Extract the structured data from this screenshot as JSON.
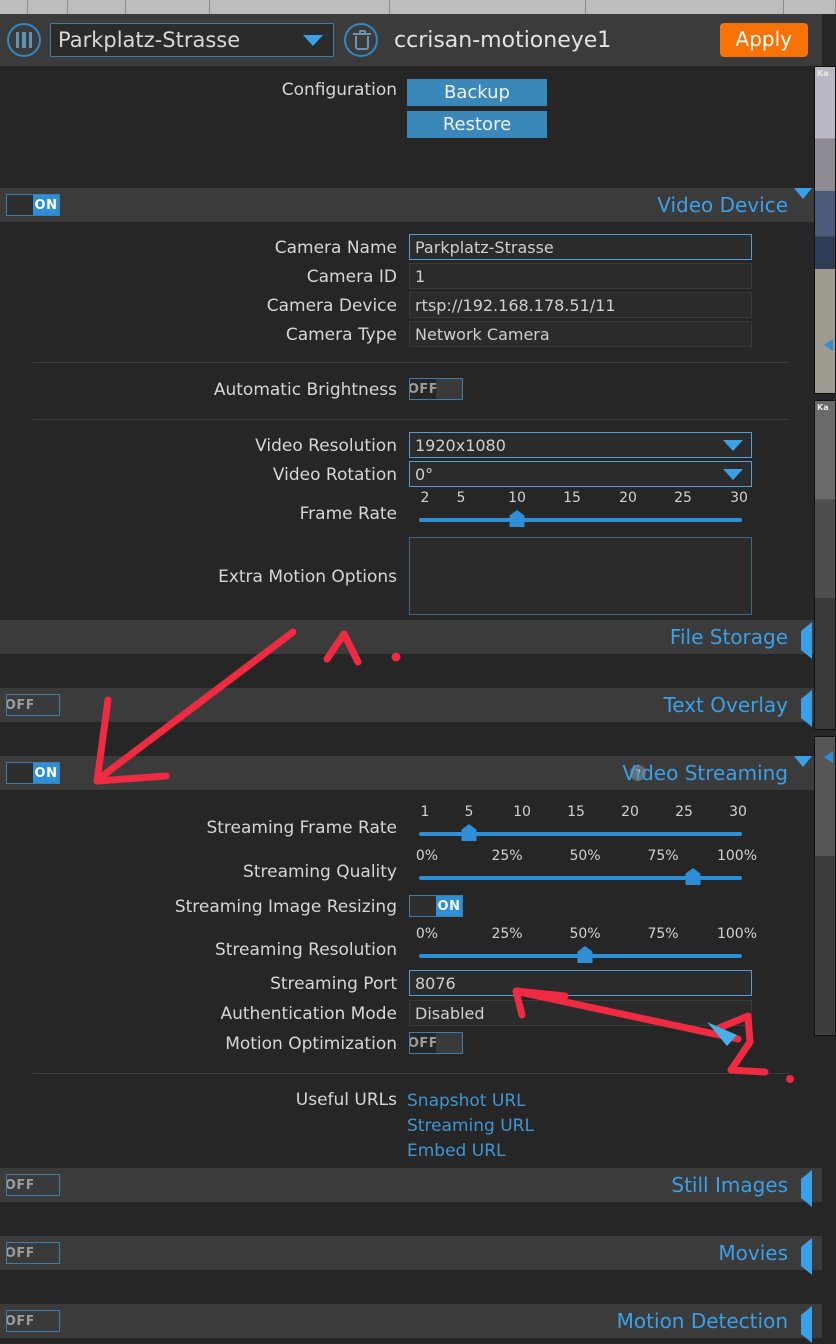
{
  "topbar": {
    "menu_icon": "menu-bars-icon",
    "camera_select_value": "Parkplatz-Strasse",
    "delete_icon": "trash-icon",
    "hostname": "ccrisan-motioneye1",
    "apply_label": "Apply"
  },
  "configuration": {
    "label": "Configuration",
    "backup_label": "Backup",
    "restore_label": "Restore"
  },
  "sections": {
    "video_device": {
      "title": "Video Device",
      "toggle": "ON",
      "expanded": true,
      "fields": [
        {
          "label": "Camera Name",
          "value": "Parkplatz-Strasse"
        },
        {
          "label": "Camera ID",
          "value": "1"
        },
        {
          "label": "Camera Device",
          "value": "rtsp://192.168.178.51/11"
        },
        {
          "label": "Camera Type",
          "value": "Network Camera"
        }
      ],
      "auto_brightness": {
        "label": "Automatic Brightness",
        "value": "OFF"
      },
      "video_resolution": {
        "label": "Video Resolution",
        "value": "1920x1080"
      },
      "video_rotation": {
        "label": "Video Rotation",
        "value": "0°"
      },
      "frame_rate": {
        "label": "Frame Rate",
        "ticks": [
          "2",
          "5",
          "10",
          "15",
          "20",
          "25",
          "30"
        ],
        "value": 10,
        "min": 2,
        "max": 30
      },
      "extra_motion_options": {
        "label": "Extra Motion Options",
        "value": ""
      }
    },
    "file_storage": {
      "title": "File Storage",
      "expanded": false
    },
    "text_overlay": {
      "title": "Text Overlay",
      "toggle": "OFF",
      "expanded": false
    },
    "video_streaming": {
      "title": "Video Streaming",
      "toggle": "ON",
      "help_icon": "question-mark-icon",
      "expanded": true,
      "streaming_frame_rate": {
        "label": "Streaming Frame Rate",
        "ticks": [
          "1",
          "5",
          "10",
          "15",
          "20",
          "25",
          "30"
        ],
        "value": 5,
        "min": 1,
        "max": 30
      },
      "streaming_quality": {
        "label": "Streaming Quality",
        "ticks": [
          "0%",
          "25%",
          "50%",
          "75%",
          "100%"
        ],
        "value": 85,
        "min": 0,
        "max": 100
      },
      "streaming_image_resizing": {
        "label": "Streaming Image Resizing",
        "value": "ON"
      },
      "streaming_resolution": {
        "label": "Streaming Resolution",
        "ticks": [
          "0%",
          "25%",
          "50%",
          "75%",
          "100%"
        ],
        "value": 50,
        "min": 0,
        "max": 100
      },
      "streaming_port": {
        "label": "Streaming Port",
        "value": "8076"
      },
      "authentication_mode": {
        "label": "Authentication Mode",
        "value": "Disabled"
      },
      "motion_optimization": {
        "label": "Motion Optimization",
        "value": "OFF"
      },
      "useful_urls": {
        "label": "Useful URLs",
        "links": [
          "Snapshot URL",
          "Streaming URL",
          "Embed URL"
        ]
      }
    },
    "still_images": {
      "title": "Still Images",
      "toggle": "OFF",
      "expanded": false
    },
    "movies": {
      "title": "Movies",
      "toggle": "OFF",
      "expanded": false
    },
    "motion_detection": {
      "title": "Motion Detection",
      "toggle": "OFF",
      "expanded": false
    }
  },
  "annotations": [
    {
      "name": "annotation-1",
      "number": "1",
      "color": "#ef2b42"
    },
    {
      "name": "annotation-2",
      "number": "2",
      "color": "#ef2b42"
    }
  ],
  "colors": {
    "accent_blue": "#3aa0e8",
    "apply_orange": "#f97206",
    "button_blue": "#3a88ba",
    "annotation_red": "#ef2b42",
    "panel_bg": "#262626",
    "header_bg": "#3b3b3b"
  }
}
